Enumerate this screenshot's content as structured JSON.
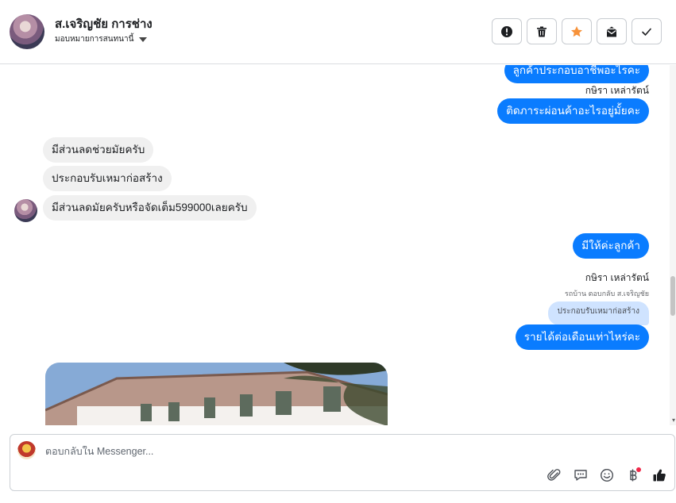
{
  "header": {
    "contact_name": "ส.เจริญชัย การช่าง",
    "assign_label": "มอบหมายการสนทนานี้",
    "actions": [
      {
        "name": "mark-spam",
        "icon": "alert-circle-icon"
      },
      {
        "name": "delete",
        "icon": "trash-icon"
      },
      {
        "name": "star",
        "icon": "star-icon"
      },
      {
        "name": "mark-unread",
        "icon": "envelope-icon"
      },
      {
        "name": "done",
        "icon": "check-icon"
      }
    ]
  },
  "messages": {
    "m1": "ลูกค้าประกอบอาชีพอะไรคะ",
    "sender1": "กษิรา เหล่ารัตน์",
    "m2": "ติดภาระผ่อนค้าอะไรอยู่มั้ยคะ",
    "m3": "มีส่วนลดช่วยมัยครับ",
    "m4": "ประกอบรับเหมาก่อสร้าง",
    "m5": "มีส่วนลดมัยครับหรือจัดเต็ม599000เลยครับ",
    "m6": "มีให้ค่ะลูกค้า",
    "sender2": "กษิรา เหล่ารัตน์",
    "reply_note": "รถบ้าน ตอบกลับ ส.เจริญชัย",
    "quoted": "ประกอบรับเหมาก่อสร้าง",
    "m7": "รายได้ต่อเดือนเท่าไหร่คะ"
  },
  "composer": {
    "placeholder": "ตอบกลับใน Messenger..."
  },
  "tools": [
    "paperclip-icon",
    "chat-bubble-icon",
    "emoji-icon",
    "baht-icon",
    "thumbs-up-icon"
  ],
  "colors": {
    "outgoing": "#0a7cff",
    "incoming": "#f0f0f0",
    "star": "#f7923a",
    "like": "#1c1e21"
  }
}
